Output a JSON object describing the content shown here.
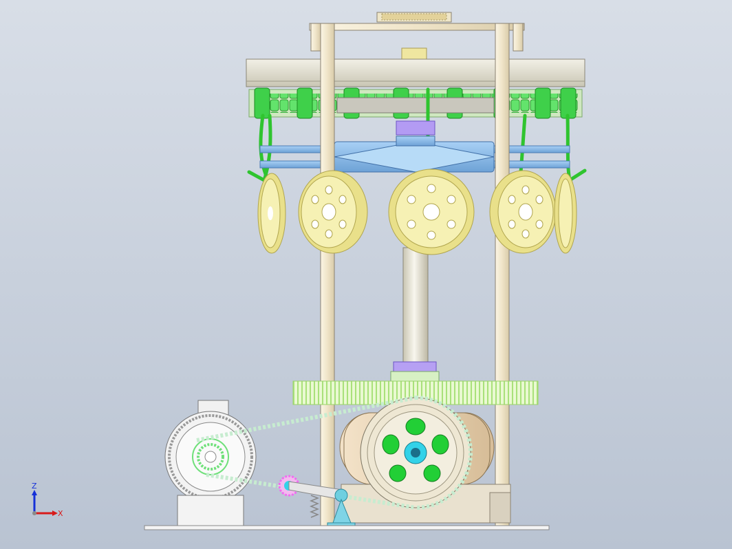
{
  "view": {
    "background_top": "#d8dee7",
    "background_bottom": "#b9c3d2"
  },
  "triad": {
    "z_label": "Z",
    "x_label": "X",
    "z_color": "#1530d8",
    "x_color": "#d81a1a"
  },
  "colors": {
    "frame": "#f1e6cd",
    "frame_edge": "#8a8170",
    "chain": "#5ee36a",
    "sprocket_blue": "#8fc0ef",
    "gear": "#f6f1b4",
    "gear_teeth": "#e9e08a",
    "shaft_purple": "#a890f0",
    "shaft": "#e7e3d4",
    "hook": "#2fc42f",
    "belt_gear": "#eee7d3",
    "pink_sprocket": "#f06cf0",
    "cyan": "#33d2e8"
  }
}
